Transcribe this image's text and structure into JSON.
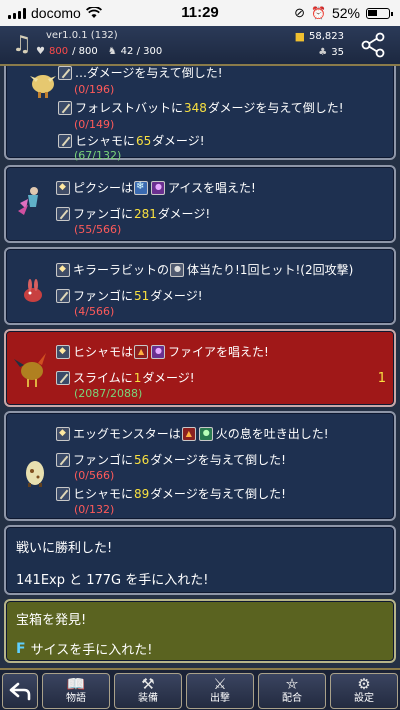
{
  "status_bar": {
    "carrier": "docomo",
    "time": "11:29",
    "battery": "52%",
    "battery_level": 0.52
  },
  "header": {
    "version": "ver1.0.1 (132)",
    "hp_current": "800",
    "hp_max": "/ 800",
    "party_count": "42 / 300",
    "gold": "58,823",
    "gems": "35"
  },
  "log": {
    "p1": {
      "top_cut": "…ダメージを与えて倒した!",
      "l1_hp": "(0/196)",
      "l2_pre": "フォレストバットに",
      "l2_num": "348",
      "l2_post": "ダメージを与えて倒した!",
      "l2_hp": "(0/149)",
      "l3_pre": "ヒシャモに",
      "l3_num": "65",
      "l3_post": "ダメージ!",
      "l3_hp": "(67/132)"
    },
    "p2": {
      "l1_pre": "ピクシーは",
      "l1_post": "アイスを唱えた!",
      "l2_pre": "ファンゴに",
      "l2_num": "281",
      "l2_post": "ダメージ!",
      "l2_hp": "(55/566)"
    },
    "p3": {
      "l1_pre": "キラーラビットの",
      "l1_post": "体当たり!1回ヒット!(2回攻撃)",
      "l2_pre": "ファンゴに",
      "l2_num": "51",
      "l2_post": "ダメージ!",
      "l2_hp": "(4/566)"
    },
    "p4": {
      "l1_pre": "ヒシャモは",
      "l1_post": "ファイアを唱えた!",
      "l2_pre": "スライムに",
      "l2_num": "1",
      "l2_post": "ダメージ!",
      "l2_hp": "(2087/2088)",
      "right_num": "1"
    },
    "p5": {
      "l1_pre": "エッグモンスターは",
      "l1_post": "火の息を吐き出した!",
      "l2_pre": "ファンゴに",
      "l2_num": "56",
      "l2_post": "ダメージを与えて倒した!",
      "l2_hp": "(0/566)",
      "l3_pre": "ヒシャモに",
      "l3_num": "89",
      "l3_post": "ダメージを与えて倒した!",
      "l3_hp": "(0/132)"
    },
    "p6": {
      "l1": "戦いに勝利した!",
      "l2": "141Exp と 177G を手に入れた!"
    },
    "p7": {
      "l1": "宝箱を発見!",
      "l2_mark": "F",
      "l2": "サイスを手に入れた!"
    }
  },
  "bottom_nav": {
    "back_icon": "back-arrow-icon",
    "items": [
      {
        "label": "物語",
        "icon": "book-icon"
      },
      {
        "label": "装備",
        "icon": "anvil-icon"
      },
      {
        "label": "出撃",
        "icon": "sword-shield-icon"
      },
      {
        "label": "配合",
        "icon": "pentagram-icon"
      },
      {
        "label": "設定",
        "icon": "gear-icon"
      }
    ]
  },
  "colors": {
    "panel": "#1e3050",
    "panel_red": "#a01818",
    "panel_olive": "#5a6320",
    "damage_yellow": "#f8e040",
    "hp_red": "#ff5a5a",
    "hp_green": "#7ad47a"
  }
}
